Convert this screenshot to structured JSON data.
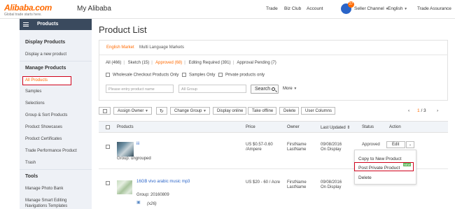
{
  "header": {
    "logo_text": "Alibaba.com",
    "logo_tagline": "Global trade starts here.",
    "title": "My Alibaba",
    "nav": {
      "trade": "Trade",
      "biz_club": "Biz Club",
      "account": "Account",
      "notifications_count": "27",
      "seller_channel": "Seller Channel",
      "language": "English",
      "trade_assurance": "Trade Assurance"
    }
  },
  "sidebar": {
    "header": "Products",
    "sections": [
      {
        "title": "Display Products",
        "items": [
          "Display a new product"
        ]
      },
      {
        "title": "Manage Products",
        "items": [
          "All Products",
          "Samples",
          "Selections",
          "Group & Sort Products",
          "Product Showcases",
          "Product Certificates",
          "Trade Performance Product",
          "Trash"
        ]
      },
      {
        "title": "Tools",
        "items": [
          "Manage Photo Bank",
          "Manage Smart Editing",
          "Navigations Templates"
        ]
      }
    ],
    "active_item": "All Products"
  },
  "main": {
    "title": "Product List",
    "tabs": {
      "english": "English Market",
      "multi": "Multi Language Markets"
    },
    "filters": {
      "all": "All (466)",
      "sketch": "Sketch (15)",
      "approved": "Approved (68)",
      "editing_required": "Editing Required (391)",
      "approval_pending": "Approval Pending (7)"
    },
    "checkboxes": {
      "wholesale": "Wholesale Checkout Products Only",
      "samples": "Samples Only",
      "private": "Private products only"
    },
    "search": {
      "placeholder": "Please entry product name",
      "group": "All Group",
      "button": "Search",
      "more": "More"
    },
    "toolbar": {
      "assign_owner": "Assign Owner",
      "change_group": "Change Group",
      "display_online": "Display online",
      "take_offline": "Take offline",
      "delete": "Delete",
      "user_columns": "User Columns",
      "page_current": "1",
      "page_total": "/ 3"
    },
    "table": {
      "headers": {
        "products": "Products",
        "price": "Price",
        "owner": "Owner",
        "last_updated": "Last Updated",
        "status": "Status",
        "action": "Action"
      },
      "rows": [
        {
          "name": "iii",
          "group": "Group: ungrouped",
          "price": "US $0.57-0.60",
          "unit": "/Ampere",
          "owner_first": "FirstName",
          "owner_last": "LastName",
          "date": "09/08/2016",
          "display": "On Display",
          "status": "Approved",
          "action": "Edit"
        },
        {
          "name": "16GB vivo arabic music mp3",
          "group": "Group: 20160809",
          "extra": "(x26)",
          "price": "US $20 - 60 / Acre",
          "owner_first": "FirstName",
          "owner_last": "LastName",
          "date": "09/08/2016",
          "display": "On Display"
        }
      ]
    },
    "action_menu": {
      "copy": "Copy to New Product",
      "post_private": "Post Private Product",
      "new_badge": "NEW",
      "delete": "Delete"
    }
  }
}
